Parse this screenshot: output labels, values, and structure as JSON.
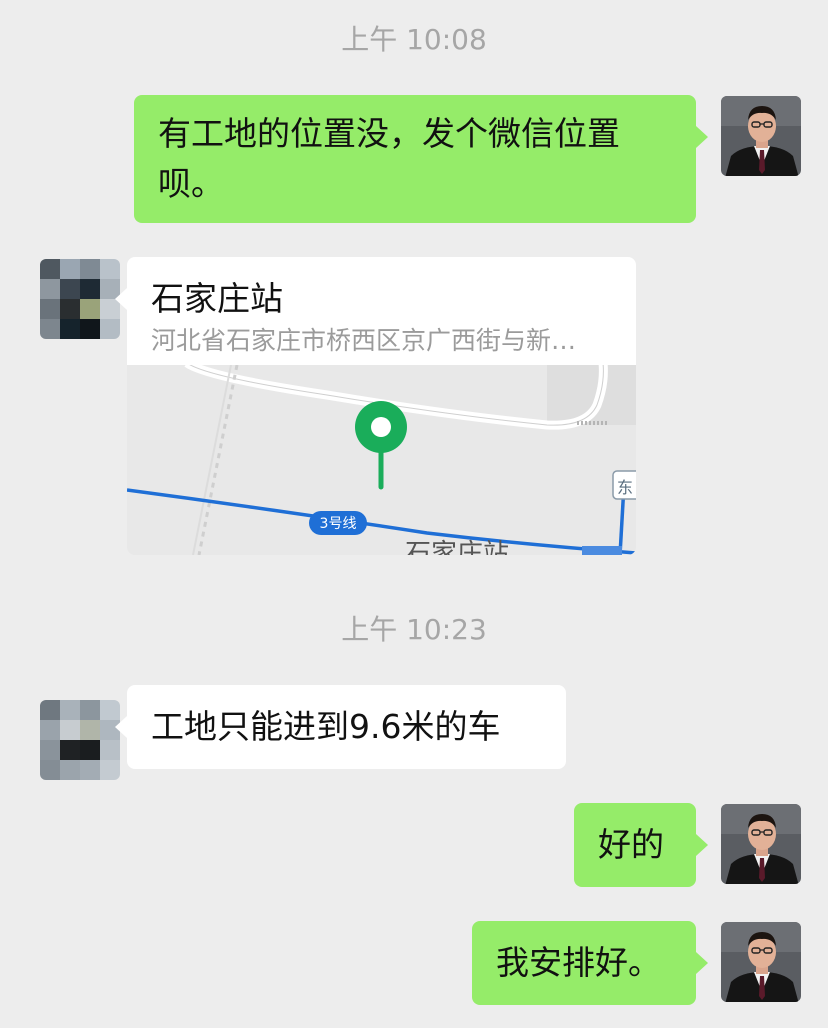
{
  "timestamps": [
    "上午 10:08",
    "上午 10:23"
  ],
  "messages": [
    {
      "side": "right",
      "text": "有工地的位置没，发个微信位置呗。",
      "line1": "有工地的位置没，发个微信位置",
      "line2": "呗。"
    },
    {
      "side": "left",
      "type": "location",
      "title": "石家庄站",
      "address": "河北省石家庄市桥西区京广西街与新…",
      "map_labels": {
        "metro_line": "3号线",
        "station": "石家庄站",
        "east_partial": "东"
      }
    },
    {
      "side": "left",
      "text": "工地只能进到9.6米的车"
    },
    {
      "side": "right",
      "text": "好的"
    },
    {
      "side": "right",
      "text": "我安排好。"
    }
  ],
  "colors": {
    "background": "#ededed",
    "self_bubble": "#95ec69",
    "other_bubble": "#ffffff",
    "timestamp": "#a6a6a6",
    "pin": "#1aad5a",
    "metro_line": "#1f6fd6"
  },
  "icons": {
    "self_avatar": "man-in-suit-avatar",
    "other_avatar": "pixelated-avatar",
    "map_pin": "location-pin-icon"
  }
}
